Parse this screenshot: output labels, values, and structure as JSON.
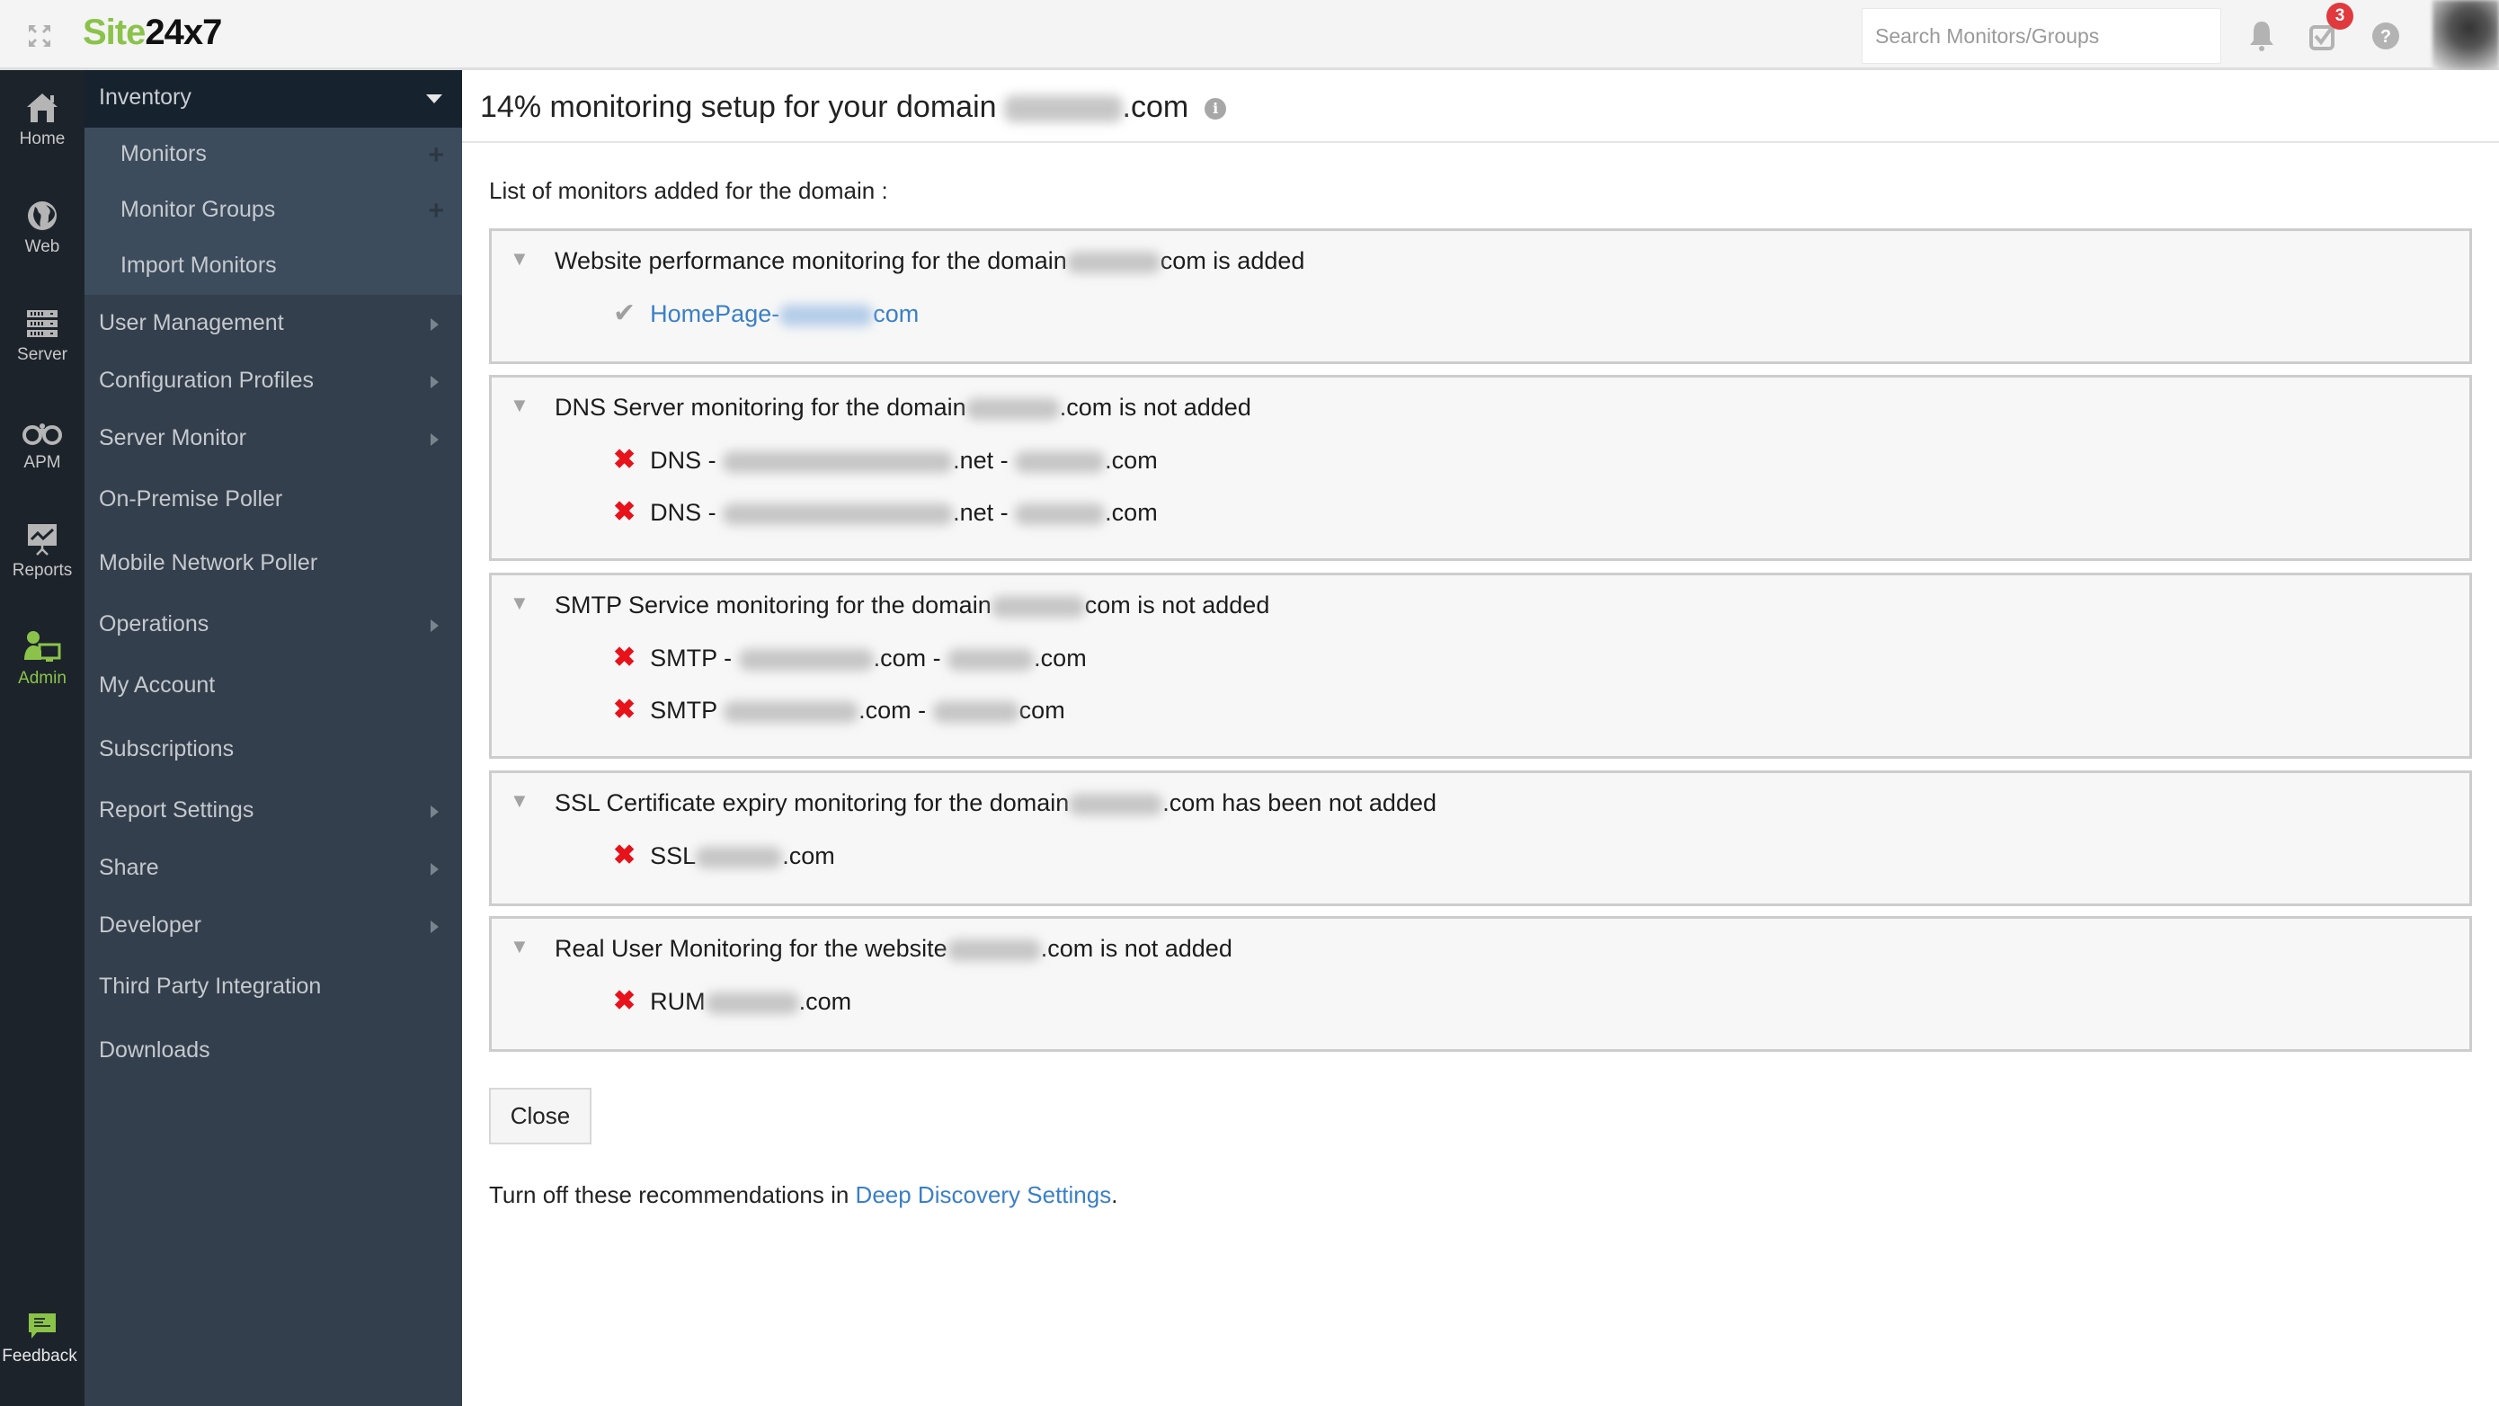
{
  "app": {
    "logo_part1": "Site",
    "logo_part2": "24x7",
    "brand_color": "#8bc34a"
  },
  "topbar": {
    "search_placeholder": "Search Monitors/Groups",
    "notification_count": "3",
    "icons": [
      "expand-icon",
      "bell-icon",
      "tasks-check-icon",
      "help-icon",
      "avatar"
    ]
  },
  "rail": {
    "items": [
      {
        "label": "Home",
        "icon": "home-icon"
      },
      {
        "label": "Web",
        "icon": "globe-icon"
      },
      {
        "label": "Server",
        "icon": "server-icon"
      },
      {
        "label": "APM",
        "icon": "binoculars-icon"
      },
      {
        "label": "Reports",
        "icon": "presentation-chart-icon"
      },
      {
        "label": "Admin",
        "icon": "admin-icon",
        "active": true
      }
    ],
    "feedback_label": "Feedback"
  },
  "menu": {
    "section": "Inventory",
    "sub_items": [
      {
        "label": "Monitors",
        "has_add": true
      },
      {
        "label": "Monitor Groups",
        "has_add": true
      },
      {
        "label": "Import Monitors",
        "has_add": false
      }
    ],
    "items": [
      {
        "label": "User Management",
        "has_arrow": true
      },
      {
        "label": "Configuration Profiles",
        "has_arrow": true
      },
      {
        "label": "Server Monitor",
        "has_arrow": true
      },
      {
        "label": "On-Premise Poller",
        "has_arrow": false
      },
      {
        "label": "Mobile Network Poller",
        "has_arrow": false
      },
      {
        "label": "Operations",
        "has_arrow": true
      },
      {
        "label": "My Account",
        "has_arrow": false
      },
      {
        "label": "Subscriptions",
        "has_arrow": false
      },
      {
        "label": "Report Settings",
        "has_arrow": true
      },
      {
        "label": "Share",
        "has_arrow": true
      },
      {
        "label": "Developer",
        "has_arrow": true
      },
      {
        "label": "Third Party Integration",
        "has_arrow": false
      },
      {
        "label": "Downloads",
        "has_arrow": false
      }
    ]
  },
  "main": {
    "title_prefix": "14% monitoring setup for your domain",
    "title_suffix": ".com",
    "setup_percent": 14,
    "list_caption": "List of monitors added for the domain :",
    "groups": [
      {
        "head_prefix": "Website performance monitoring for the domain",
        "head_suffix": "com is added",
        "status": "added",
        "rows": [
          {
            "prefix": "HomePage-",
            "suffix": "com",
            "status": "added",
            "link": true
          }
        ]
      },
      {
        "head_prefix": "DNS Server monitoring for the domain",
        "head_suffix": ".com is not added",
        "status": "not_added",
        "rows": [
          {
            "prefix": "DNS - ",
            "middle": ".net - ",
            "suffix": ".com",
            "status": "not_added"
          },
          {
            "prefix": "DNS - ",
            "middle": ".net - ",
            "suffix": ".com",
            "status": "not_added"
          }
        ]
      },
      {
        "head_prefix": "SMTP Service monitoring for the domain",
        "head_suffix": "com is not added",
        "status": "not_added",
        "rows": [
          {
            "prefix": "SMTP - ",
            "middle": ".com - ",
            "suffix": ".com",
            "status": "not_added"
          },
          {
            "prefix": "SMTP ",
            "middle": ".com - ",
            "suffix": "com",
            "status": "not_added"
          }
        ]
      },
      {
        "head_prefix": "SSL Certificate expiry monitoring for the domain",
        "head_suffix": ".com has been not added",
        "status": "not_added",
        "rows": [
          {
            "prefix": "SSL",
            "suffix": ".com",
            "status": "not_added"
          }
        ]
      },
      {
        "head_prefix": "Real User Monitoring for the website",
        "head_suffix": ".com is not added",
        "status": "not_added",
        "rows": [
          {
            "prefix": "RUM",
            "suffix": ".com",
            "status": "not_added"
          }
        ]
      }
    ],
    "close_label": "Close",
    "footer_text": "Turn off these recommendations in ",
    "footer_link": "Deep Discovery Settings",
    "footer_end": "."
  },
  "colors": {
    "added_check": "#a0a0a0",
    "not_added_x": "#e8121b",
    "link": "#3a7fc8",
    "badge": "#e0393e"
  }
}
